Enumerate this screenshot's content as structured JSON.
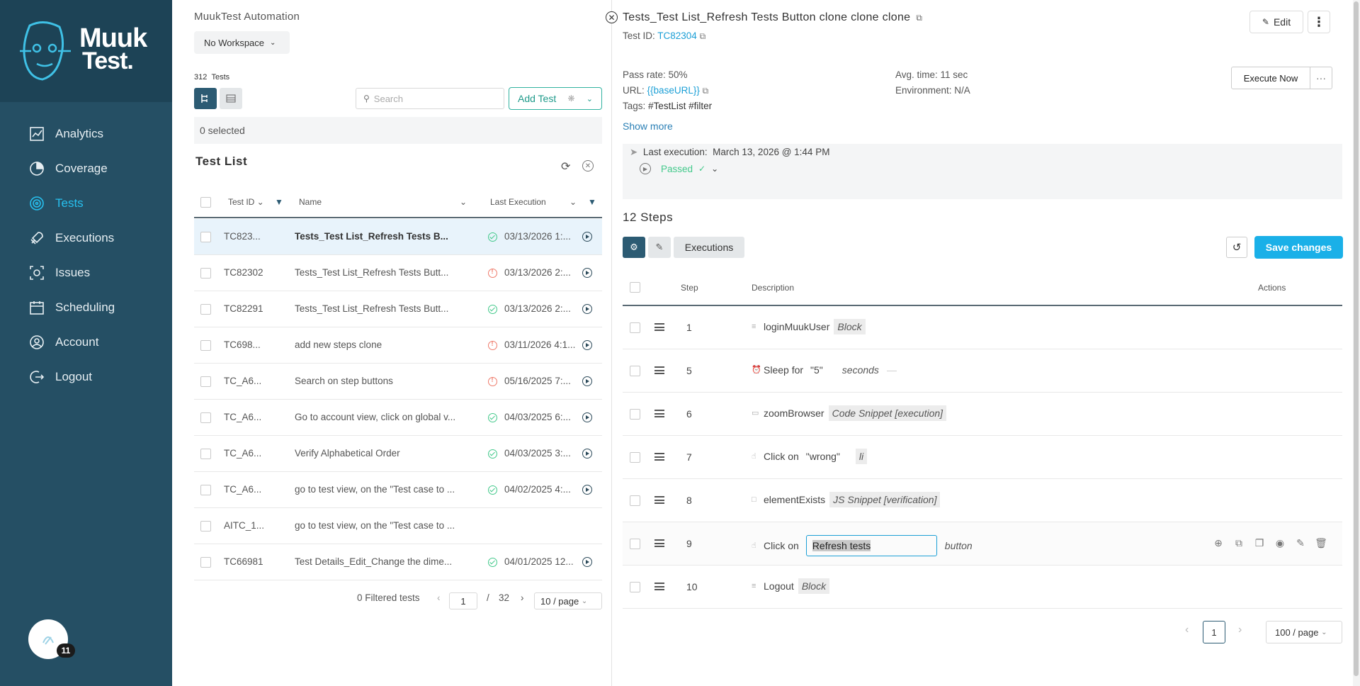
{
  "sidebar": {
    "logo": {
      "line1": "Muuk",
      "line2": "Test."
    },
    "items": [
      {
        "label": "Analytics",
        "icon": "analytics-icon",
        "active": false
      },
      {
        "label": "Coverage",
        "icon": "coverage-icon",
        "active": false
      },
      {
        "label": "Tests",
        "icon": "tests-icon",
        "active": true
      },
      {
        "label": "Executions",
        "icon": "executions-icon",
        "active": false
      },
      {
        "label": "Issues",
        "icon": "issues-icon",
        "active": false
      },
      {
        "label": "Scheduling",
        "icon": "scheduling-icon",
        "active": false
      },
      {
        "label": "Account",
        "icon": "account-icon",
        "active": false
      },
      {
        "label": "Logout",
        "icon": "logout-icon",
        "active": false
      }
    ],
    "avatar_badge": "11",
    "accent": "#27c0ef"
  },
  "list_pane": {
    "app_title": "MuukTest Automation",
    "workspace": "No Workspace",
    "tests_count": "312",
    "tests_label": "Tests",
    "search_placeholder": "Search",
    "add_test": "Add Test",
    "selected": "0 selected",
    "list_title": "Test List",
    "columns": {
      "id": "Test ID",
      "name": "Name",
      "last_execution": "Last Execution"
    },
    "rows": [
      {
        "id": "TC823...",
        "name": "Tests_Test List_Refresh Tests B...",
        "status": "ok",
        "date": "03/13/2026 1:...",
        "selected": true
      },
      {
        "id": "TC82302",
        "name": "Tests_Test List_Refresh Tests Butt...",
        "status": "err",
        "date": "03/13/2026 2:...",
        "selected": false
      },
      {
        "id": "TC82291",
        "name": "Tests_Test List_Refresh Tests Butt...",
        "status": "ok",
        "date": "03/13/2026 2:...",
        "selected": false
      },
      {
        "id": "TC698...",
        "name": "add new steps clone",
        "status": "err",
        "date": "03/11/2026 4:1...",
        "selected": false
      },
      {
        "id": "TC_A6...",
        "name": "Search on step buttons",
        "status": "err",
        "date": "05/16/2025 7:...",
        "selected": false
      },
      {
        "id": "TC_A6...",
        "name": "Go to account view, click on global v...",
        "status": "ok",
        "date": "04/03/2025 6:...",
        "selected": false
      },
      {
        "id": "TC_A6...",
        "name": "Verify Alphabetical Order",
        "status": "ok",
        "date": "04/03/2025 3:...",
        "selected": false
      },
      {
        "id": "TC_A6...",
        "name": "go to test view, on the \"Test case to ...",
        "status": "ok",
        "date": "04/02/2025 4:...",
        "selected": false
      },
      {
        "id": "AITC_1...",
        "name": "go to test view, on the \"Test case to ...",
        "status": "",
        "date": "",
        "selected": false
      },
      {
        "id": "TC66981",
        "name": "Test Details_Edit_Change the dime...",
        "status": "ok",
        "date": "04/01/2025 12...",
        "selected": false
      }
    ],
    "pager": {
      "filtered": "0 Filtered tests",
      "page": "1",
      "sep": "/",
      "total": "32",
      "per_page": "10 / page"
    }
  },
  "detail": {
    "title": "Tests_Test List_Refresh Tests Button clone clone clone",
    "test_id_label": "Test ID:",
    "test_id": "TC82304",
    "edit": "Edit",
    "pass_rate": "Pass rate: 50%",
    "url_label": "URL:",
    "url": "{{baseURL}}",
    "tags_label": "Tags:",
    "tags": "#TestList #filter",
    "avg_time": "Avg. time: 11 sec",
    "environment": "Environment: N/A",
    "execute_now": "Execute Now",
    "show_more": "Show more",
    "last_execution_label": "Last execution:",
    "last_execution": "March 13, 2026 @ 1:44 PM",
    "status": "Passed",
    "steps_title": "12 Steps",
    "executions_tab": "Executions",
    "save_changes": "Save changes",
    "columns": {
      "step": "Step",
      "description": "Description",
      "actions": "Actions"
    },
    "steps": [
      {
        "num": "1",
        "icon": "list-icon",
        "text": "loginMuukUser",
        "value": "",
        "tag": "Block",
        "tag_style": "gray"
      },
      {
        "num": "5",
        "icon": "alarm-icon",
        "text": "Sleep for",
        "value": "\"5\"",
        "tag": "seconds",
        "tag_style": "plain"
      },
      {
        "num": "6",
        "icon": "window-icon",
        "text": "zoomBrowser",
        "value": "",
        "tag": "Code Snippet [execution]",
        "tag_style": "gray"
      },
      {
        "num": "7",
        "icon": "click-icon",
        "text": "Click on",
        "value": "\"wrong\"",
        "tag": "li",
        "tag_style": "gray"
      },
      {
        "num": "8",
        "icon": "box-icon",
        "text": "elementExists",
        "value": "",
        "tag": "JS Snippet [verification]",
        "tag_style": "gray"
      },
      {
        "num": "9",
        "icon": "click-icon",
        "text": "Click on",
        "value": "",
        "tag": "button",
        "tag_style": "plain",
        "editing": "Refresh tests"
      },
      {
        "num": "10",
        "icon": "list-icon",
        "text": "Logout",
        "value": "",
        "tag": "Block",
        "tag_style": "gray"
      }
    ],
    "pager": {
      "page": "1",
      "per_page": "100 / page"
    },
    "accent": "#1ab0e8"
  }
}
